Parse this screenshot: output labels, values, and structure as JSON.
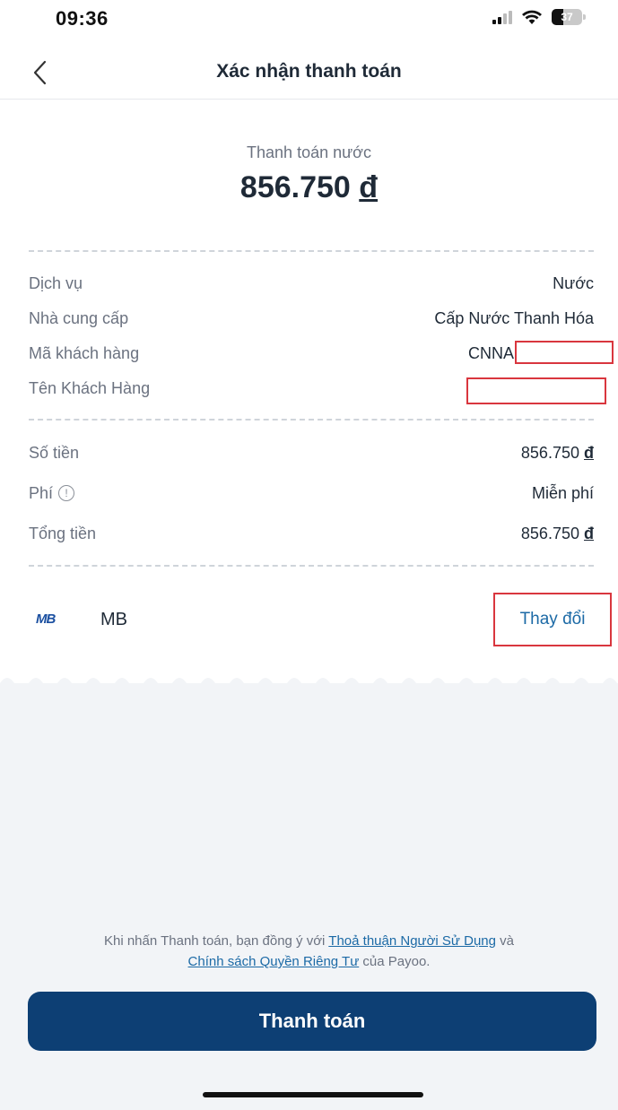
{
  "status_bar": {
    "time": "09:36",
    "battery": "37",
    "battery_level": 0.37
  },
  "header": {
    "title": "Xác nhận thanh toán"
  },
  "summary": {
    "label": "Thanh toán nước",
    "amount": "856.750",
    "currency": "đ"
  },
  "details": [
    {
      "label": "Dịch vụ",
      "value": "Nước"
    },
    {
      "label": "Nhà cung cấp",
      "value": "Cấp Nước Thanh Hóa"
    },
    {
      "label": "Mã khách hàng",
      "value": "CNNA"
    },
    {
      "label": "Tên Khách Hàng",
      "value": ""
    }
  ],
  "amounts": [
    {
      "label": "Số tiền",
      "value": "856.750",
      "currency": "đ"
    },
    {
      "label": "Phí",
      "value": "Miễn phí"
    },
    {
      "label": "Tổng tiền",
      "value": "856.750",
      "currency": "đ"
    }
  ],
  "payment_source": {
    "logo_text": "MB",
    "name": "MB",
    "change_label": "Thay đổi"
  },
  "terms": {
    "prefix": "Khi nhấn Thanh toán, bạn đồng ý với ",
    "link1": "Thoả thuận Người Sử Dụng",
    "middle": " và",
    "link2": "Chính sách Quyền Riêng Tư",
    "suffix": " của Payoo."
  },
  "pay_button": {
    "label": "Thanh toán"
  },
  "colors": {
    "primary": "#0d3f74",
    "link": "#1c6aa6",
    "highlight_box": "#d9363e",
    "bottom_bg": "#f2f4f7"
  }
}
